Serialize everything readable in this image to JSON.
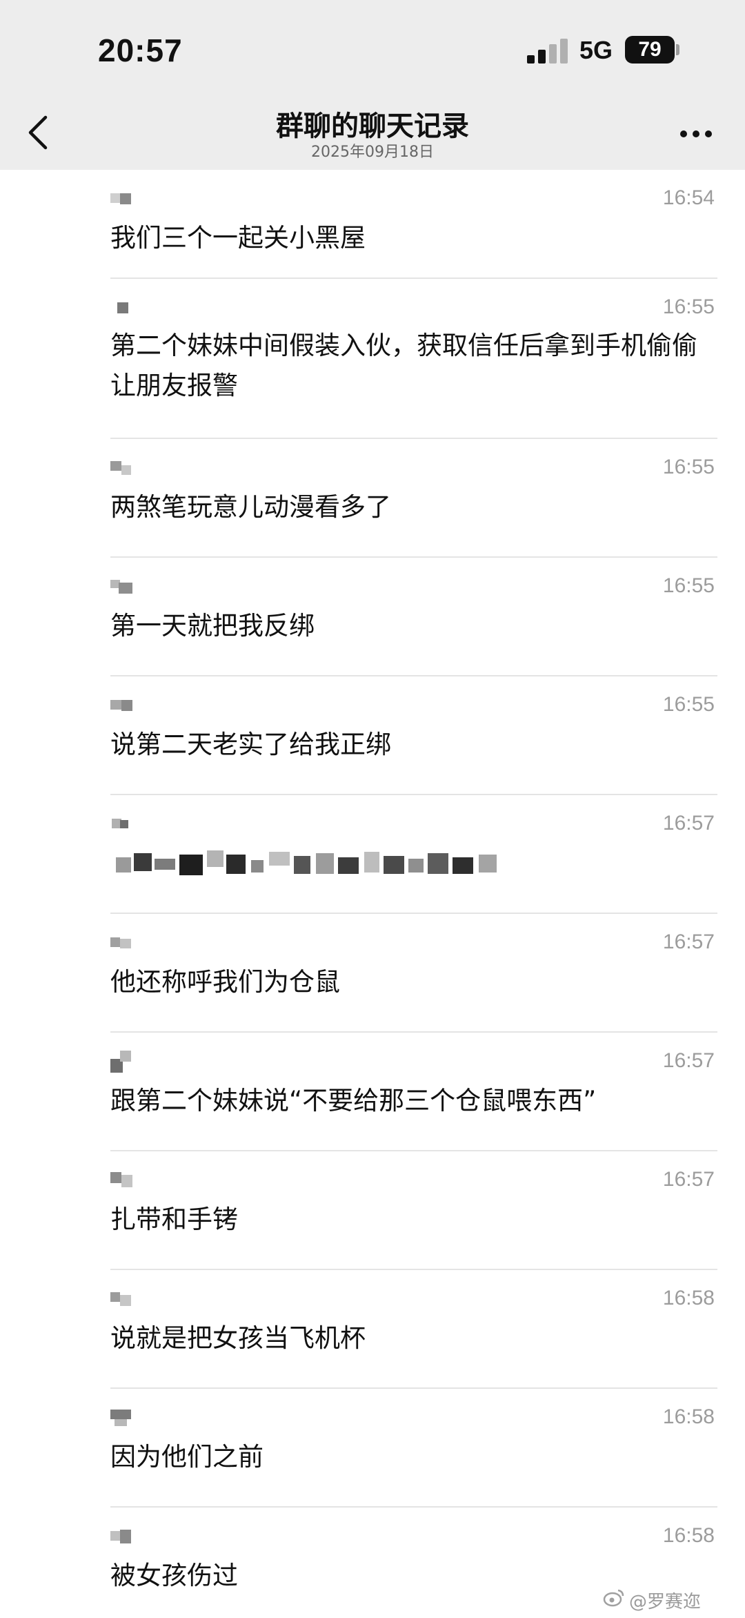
{
  "status_bar": {
    "time": "20:57",
    "network": "5G",
    "battery": "79"
  },
  "nav": {
    "title": "群聊的聊天记录",
    "subtitle": "2025年09月18日",
    "back_icon": "chevron-left-icon",
    "more_icon": "ellipsis-icon"
  },
  "messages": [
    {
      "time": "16:54",
      "text": "我们三个一起关小黑屋"
    },
    {
      "time": "16:55",
      "text": "第二个妹妹中间假装入伙，获取信任后拿到手机偷偷让朋友报警"
    },
    {
      "time": "16:55",
      "text": "两煞笔玩意儿动漫看多了"
    },
    {
      "time": "16:55",
      "text": "第一天就把我反绑"
    },
    {
      "time": "16:55",
      "text": "说第二天老实了给我正绑"
    },
    {
      "time": "16:57",
      "text": ""
    },
    {
      "time": "16:57",
      "text": "他还称呼我们为仓鼠"
    },
    {
      "time": "16:57",
      "text": "跟第二个妹妹说“不要给那三个仓鼠喂东西”"
    },
    {
      "time": "16:57",
      "text": "扎带和手铐"
    },
    {
      "time": "16:58",
      "text": "说就是把女孩当飞机杯"
    },
    {
      "time": "16:58",
      "text": "因为他们之前"
    },
    {
      "time": "16:58",
      "text": "被女孩伤过"
    }
  ],
  "watermark": {
    "text": "@罗赛迩"
  },
  "colors": {
    "header_bg": "#ededed",
    "timestamp": "#9c9c9c",
    "divider": "#e4e4e4"
  }
}
